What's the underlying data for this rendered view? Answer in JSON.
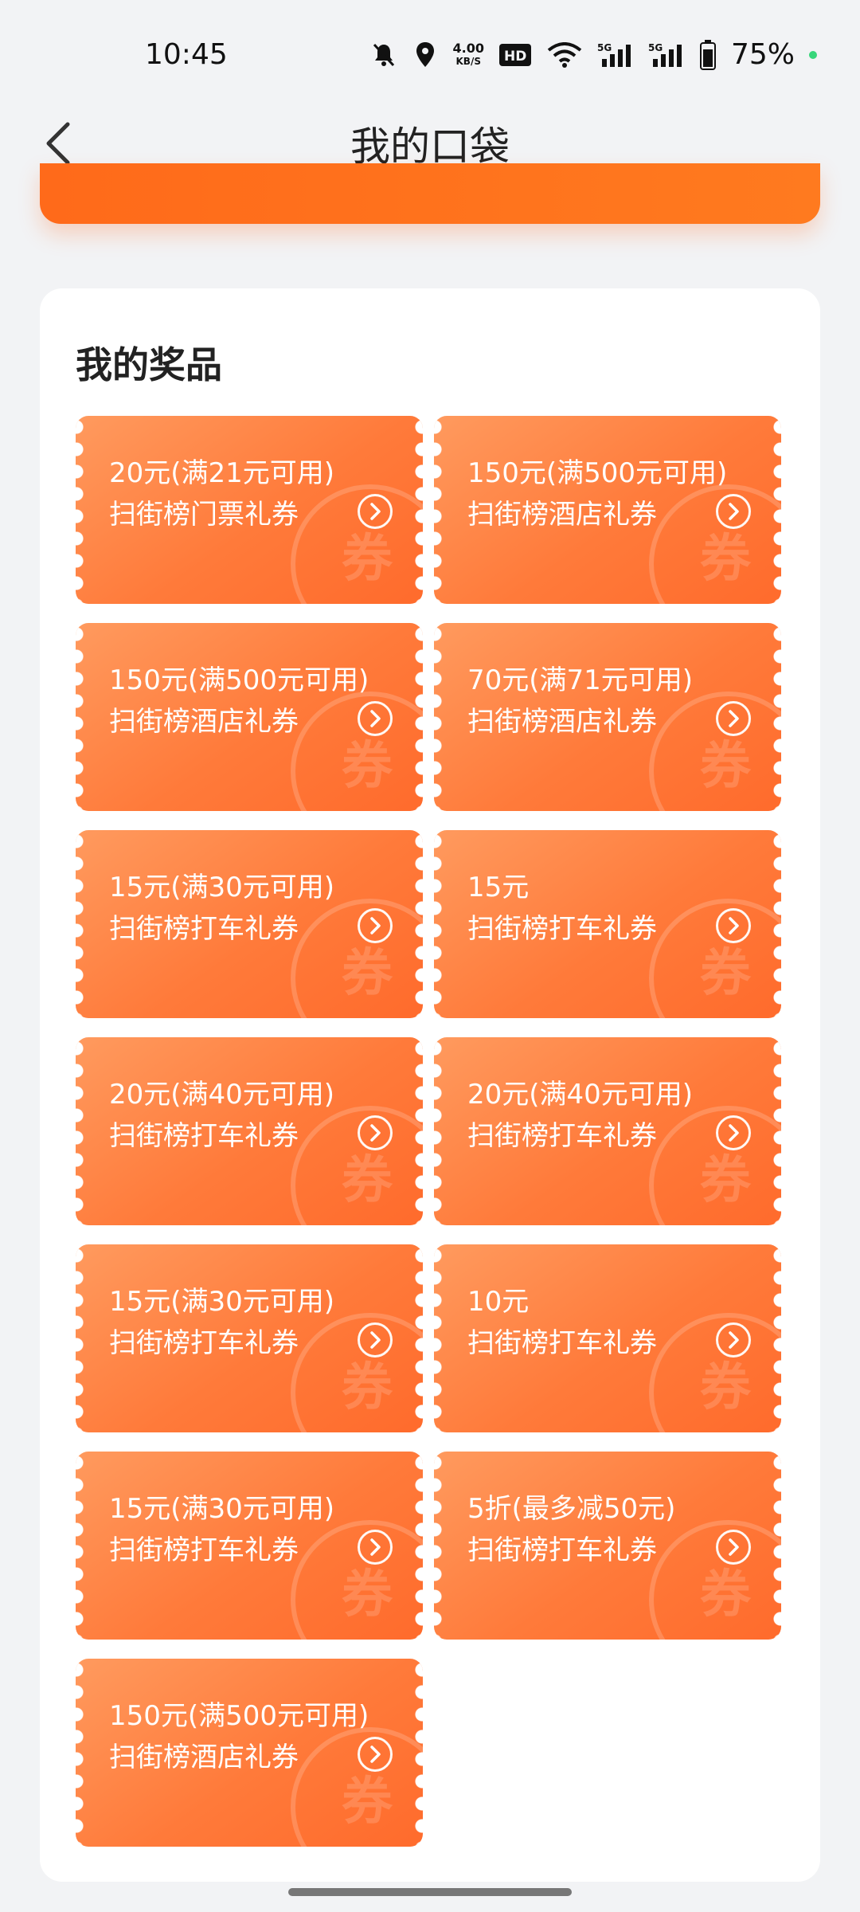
{
  "status_bar": {
    "time": "10:45",
    "net_speed_value": "4.00",
    "net_speed_unit": "KB/S",
    "hd_label": "HD",
    "battery_percent": "75%",
    "icons": [
      "bell-muted-icon",
      "location-icon",
      "hd-icon",
      "wifi-icon",
      "signal-5g-icon",
      "signal-5g-icon",
      "battery-icon"
    ]
  },
  "nav": {
    "title": "我的口袋"
  },
  "prizes": {
    "section_title": "我的奖品",
    "watermark_char": "券",
    "coupons": [
      {
        "amount": "20元(满21元可用)",
        "name": "扫街榜门票礼券"
      },
      {
        "amount": "150元(满500元可用)",
        "name": "扫街榜酒店礼券"
      },
      {
        "amount": "150元(满500元可用)",
        "name": "扫街榜酒店礼券"
      },
      {
        "amount": "70元(满71元可用)",
        "name": "扫街榜酒店礼券"
      },
      {
        "amount": "15元(满30元可用)",
        "name": "扫街榜打车礼券"
      },
      {
        "amount": "15元",
        "name": "扫街榜打车礼券"
      },
      {
        "amount": "20元(满40元可用)",
        "name": "扫街榜打车礼券"
      },
      {
        "amount": "20元(满40元可用)",
        "name": "扫街榜打车礼券"
      },
      {
        "amount": "15元(满30元可用)",
        "name": "扫街榜打车礼券"
      },
      {
        "amount": "10元",
        "name": "扫街榜打车礼券"
      },
      {
        "amount": "15元(满30元可用)",
        "name": "扫街榜打车礼券"
      },
      {
        "amount": "5折(最多减50元)",
        "name": "扫街榜打车礼券"
      },
      {
        "amount": "150元(满500元可用)",
        "name": "扫街榜酒店礼券"
      }
    ]
  },
  "colors": {
    "coupon_start": "#ff9a5e",
    "coupon_end": "#ff6b2c",
    "banner": "#ff6a1a"
  }
}
